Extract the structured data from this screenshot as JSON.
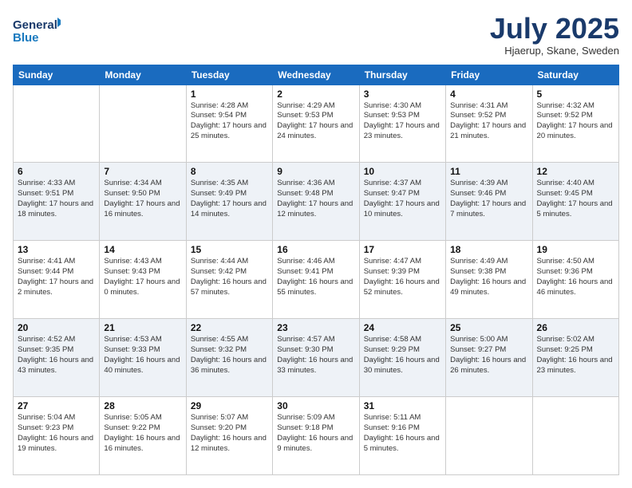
{
  "header": {
    "logo_general": "General",
    "logo_blue": "Blue",
    "month_title": "July 2025",
    "location": "Hjaerup, Skane, Sweden"
  },
  "days_of_week": [
    "Sunday",
    "Monday",
    "Tuesday",
    "Wednesday",
    "Thursday",
    "Friday",
    "Saturday"
  ],
  "weeks": [
    [
      {
        "day": "",
        "info": ""
      },
      {
        "day": "",
        "info": ""
      },
      {
        "day": "1",
        "info": "Sunrise: 4:28 AM\nSunset: 9:54 PM\nDaylight: 17 hours and 25 minutes."
      },
      {
        "day": "2",
        "info": "Sunrise: 4:29 AM\nSunset: 9:53 PM\nDaylight: 17 hours and 24 minutes."
      },
      {
        "day": "3",
        "info": "Sunrise: 4:30 AM\nSunset: 9:53 PM\nDaylight: 17 hours and 23 minutes."
      },
      {
        "day": "4",
        "info": "Sunrise: 4:31 AM\nSunset: 9:52 PM\nDaylight: 17 hours and 21 minutes."
      },
      {
        "day": "5",
        "info": "Sunrise: 4:32 AM\nSunset: 9:52 PM\nDaylight: 17 hours and 20 minutes."
      }
    ],
    [
      {
        "day": "6",
        "info": "Sunrise: 4:33 AM\nSunset: 9:51 PM\nDaylight: 17 hours and 18 minutes."
      },
      {
        "day": "7",
        "info": "Sunrise: 4:34 AM\nSunset: 9:50 PM\nDaylight: 17 hours and 16 minutes."
      },
      {
        "day": "8",
        "info": "Sunrise: 4:35 AM\nSunset: 9:49 PM\nDaylight: 17 hours and 14 minutes."
      },
      {
        "day": "9",
        "info": "Sunrise: 4:36 AM\nSunset: 9:48 PM\nDaylight: 17 hours and 12 minutes."
      },
      {
        "day": "10",
        "info": "Sunrise: 4:37 AM\nSunset: 9:47 PM\nDaylight: 17 hours and 10 minutes."
      },
      {
        "day": "11",
        "info": "Sunrise: 4:39 AM\nSunset: 9:46 PM\nDaylight: 17 hours and 7 minutes."
      },
      {
        "day": "12",
        "info": "Sunrise: 4:40 AM\nSunset: 9:45 PM\nDaylight: 17 hours and 5 minutes."
      }
    ],
    [
      {
        "day": "13",
        "info": "Sunrise: 4:41 AM\nSunset: 9:44 PM\nDaylight: 17 hours and 2 minutes."
      },
      {
        "day": "14",
        "info": "Sunrise: 4:43 AM\nSunset: 9:43 PM\nDaylight: 17 hours and 0 minutes."
      },
      {
        "day": "15",
        "info": "Sunrise: 4:44 AM\nSunset: 9:42 PM\nDaylight: 16 hours and 57 minutes."
      },
      {
        "day": "16",
        "info": "Sunrise: 4:46 AM\nSunset: 9:41 PM\nDaylight: 16 hours and 55 minutes."
      },
      {
        "day": "17",
        "info": "Sunrise: 4:47 AM\nSunset: 9:39 PM\nDaylight: 16 hours and 52 minutes."
      },
      {
        "day": "18",
        "info": "Sunrise: 4:49 AM\nSunset: 9:38 PM\nDaylight: 16 hours and 49 minutes."
      },
      {
        "day": "19",
        "info": "Sunrise: 4:50 AM\nSunset: 9:36 PM\nDaylight: 16 hours and 46 minutes."
      }
    ],
    [
      {
        "day": "20",
        "info": "Sunrise: 4:52 AM\nSunset: 9:35 PM\nDaylight: 16 hours and 43 minutes."
      },
      {
        "day": "21",
        "info": "Sunrise: 4:53 AM\nSunset: 9:33 PM\nDaylight: 16 hours and 40 minutes."
      },
      {
        "day": "22",
        "info": "Sunrise: 4:55 AM\nSunset: 9:32 PM\nDaylight: 16 hours and 36 minutes."
      },
      {
        "day": "23",
        "info": "Sunrise: 4:57 AM\nSunset: 9:30 PM\nDaylight: 16 hours and 33 minutes."
      },
      {
        "day": "24",
        "info": "Sunrise: 4:58 AM\nSunset: 9:29 PM\nDaylight: 16 hours and 30 minutes."
      },
      {
        "day": "25",
        "info": "Sunrise: 5:00 AM\nSunset: 9:27 PM\nDaylight: 16 hours and 26 minutes."
      },
      {
        "day": "26",
        "info": "Sunrise: 5:02 AM\nSunset: 9:25 PM\nDaylight: 16 hours and 23 minutes."
      }
    ],
    [
      {
        "day": "27",
        "info": "Sunrise: 5:04 AM\nSunset: 9:23 PM\nDaylight: 16 hours and 19 minutes."
      },
      {
        "day": "28",
        "info": "Sunrise: 5:05 AM\nSunset: 9:22 PM\nDaylight: 16 hours and 16 minutes."
      },
      {
        "day": "29",
        "info": "Sunrise: 5:07 AM\nSunset: 9:20 PM\nDaylight: 16 hours and 12 minutes."
      },
      {
        "day": "30",
        "info": "Sunrise: 5:09 AM\nSunset: 9:18 PM\nDaylight: 16 hours and 9 minutes."
      },
      {
        "day": "31",
        "info": "Sunrise: 5:11 AM\nSunset: 9:16 PM\nDaylight: 16 hours and 5 minutes."
      },
      {
        "day": "",
        "info": ""
      },
      {
        "day": "",
        "info": ""
      }
    ]
  ]
}
